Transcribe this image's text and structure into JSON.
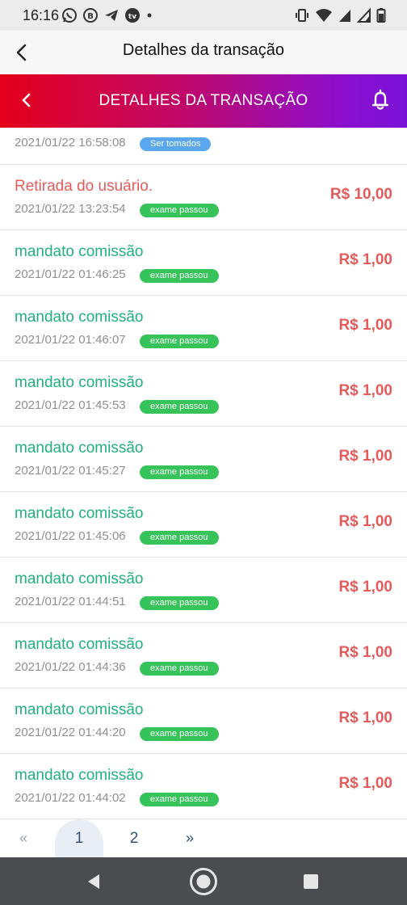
{
  "status_bar": {
    "time": "16:16",
    "left_icons": [
      "whatsapp-icon",
      "b-app-icon",
      "telegram-icon",
      "tv-icon",
      "dot-icon"
    ],
    "right_icons": [
      "vibrate-icon",
      "wifi-icon",
      "signal-icon",
      "signal-icon",
      "battery-icon"
    ]
  },
  "app_header": {
    "title": "Detalhes da transação"
  },
  "banner": {
    "title": "DETALHES DA TRANSAÇÃO"
  },
  "colors": {
    "green": "#22b07d",
    "red": "#e55b5b",
    "badge_green": "#35c35a",
    "badge_blue": "#5aa7ef"
  },
  "transactions": [
    {
      "title": "",
      "date": "2021/01/22 16:58:08",
      "status": "Ser tomados",
      "amount": ""
    },
    {
      "title": "Retirada do usuário.",
      "date": "2021/01/22 13:23:54",
      "status": "exame passou",
      "amount": "R$ 10,00"
    },
    {
      "title": "mandato comissão",
      "date": "2021/01/22 01:46:25",
      "status": "exame passou",
      "amount": "R$ 1,00"
    },
    {
      "title": "mandato comissão",
      "date": "2021/01/22 01:46:07",
      "status": "exame passou",
      "amount": "R$ 1,00"
    },
    {
      "title": "mandato comissão",
      "date": "2021/01/22 01:45:53",
      "status": "exame passou",
      "amount": "R$ 1,00"
    },
    {
      "title": "mandato comissão",
      "date": "2021/01/22 01:45:27",
      "status": "exame passou",
      "amount": "R$ 1,00"
    },
    {
      "title": "mandato comissão",
      "date": "2021/01/22 01:45:06",
      "status": "exame passou",
      "amount": "R$ 1,00"
    },
    {
      "title": "mandato comissão",
      "date": "2021/01/22 01:44:51",
      "status": "exame passou",
      "amount": "R$ 1,00"
    },
    {
      "title": "mandato comissão",
      "date": "2021/01/22 01:44:36",
      "status": "exame passou",
      "amount": "R$ 1,00"
    },
    {
      "title": "mandato comissão",
      "date": "2021/01/22 01:44:20",
      "status": "exame passou",
      "amount": "R$ 1,00"
    },
    {
      "title": "mandato comissão",
      "date": "2021/01/22 01:44:02",
      "status": "exame passou",
      "amount": "R$ 1,00"
    }
  ],
  "pagination": {
    "prev": "«",
    "pages": [
      "1",
      "2"
    ],
    "next": "»",
    "current": "1"
  },
  "nav_bar": {
    "buttons": [
      "back-triangle-icon",
      "home-circle-icon",
      "recents-square-icon"
    ]
  }
}
